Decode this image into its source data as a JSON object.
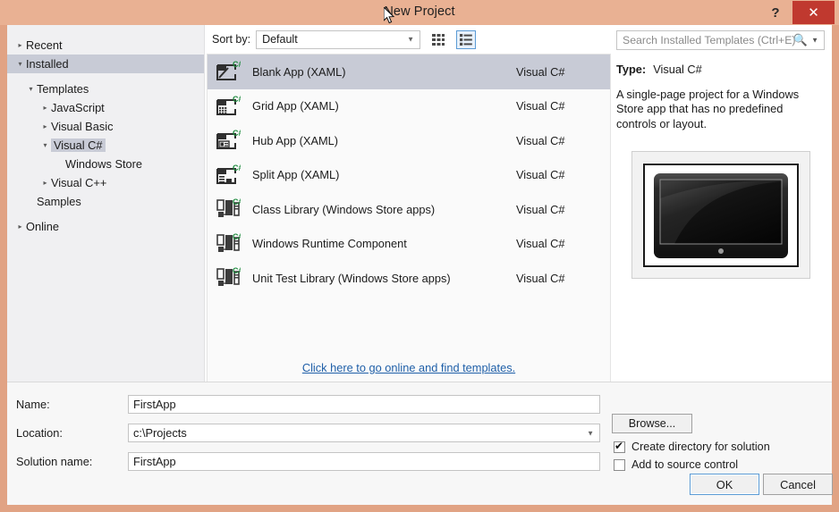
{
  "window": {
    "title": "New Project",
    "help_label": "?",
    "close_label": "✕"
  },
  "sidebar": {
    "items": [
      {
        "label": "Recent",
        "depth": 0,
        "state": "collapsed",
        "selected": false
      },
      {
        "label": "Installed",
        "depth": 0,
        "state": "expanded",
        "selected": true
      },
      {
        "label": "Templates",
        "depth": 1,
        "state": "expanded",
        "selected": false
      },
      {
        "label": "JavaScript",
        "depth": 2,
        "state": "collapsed",
        "selected": false
      },
      {
        "label": "Visual Basic",
        "depth": 2,
        "state": "collapsed",
        "selected": false
      },
      {
        "label": "Visual C#",
        "depth": 2,
        "state": "expanded",
        "selected": true
      },
      {
        "label": "Windows Store",
        "depth": 3,
        "state": "blank",
        "selected": false
      },
      {
        "label": "Visual C++",
        "depth": 2,
        "state": "collapsed",
        "selected": false
      },
      {
        "label": "Samples",
        "depth": 1,
        "state": "blank",
        "selected": false
      },
      {
        "label": "Online",
        "depth": 0,
        "state": "collapsed",
        "selected": false
      }
    ]
  },
  "toolbar": {
    "sort_label": "Sort by:",
    "sort_value": "Default",
    "tile_view_name": "tile-view",
    "list_view_name": "list-view",
    "list_view_active": true
  },
  "templates": {
    "rows": [
      {
        "name": "Blank App (XAML)",
        "lang": "Visual C#",
        "icon": "blank-app-icon",
        "selected": true
      },
      {
        "name": "Grid App (XAML)",
        "lang": "Visual C#",
        "icon": "grid-app-icon",
        "selected": false
      },
      {
        "name": "Hub App (XAML)",
        "lang": "Visual C#",
        "icon": "hub-app-icon",
        "selected": false
      },
      {
        "name": "Split App (XAML)",
        "lang": "Visual C#",
        "icon": "split-app-icon",
        "selected": false
      },
      {
        "name": "Class Library (Windows Store apps)",
        "lang": "Visual C#",
        "icon": "class-library-icon",
        "selected": false
      },
      {
        "name": "Windows Runtime Component",
        "lang": "Visual C#",
        "icon": "class-library-icon",
        "selected": false
      },
      {
        "name": "Unit Test Library (Windows Store apps)",
        "lang": "Visual C#",
        "icon": "class-library-icon",
        "selected": false
      }
    ],
    "online_link": "Click here to go online and find templates."
  },
  "search": {
    "placeholder": "Search Installed Templates (Ctrl+E)",
    "value": ""
  },
  "details": {
    "type_label": "Type:",
    "type_value": "Visual C#",
    "description": "A single-page project for a Windows Store app that has no predefined controls or layout.",
    "preview_name": "template-preview-monitor"
  },
  "form": {
    "name_label": "Name:",
    "name_value": "FirstApp",
    "location_label": "Location:",
    "location_value": "c:\\Projects",
    "solution_label": "Solution name:",
    "solution_value": "FirstApp",
    "browse_label": "Browse...",
    "create_dir_label": "Create directory for solution",
    "create_dir_checked": true,
    "source_control_label": "Add to source control",
    "source_control_checked": false,
    "ok_label": "OK",
    "cancel_label": "Cancel"
  },
  "colors": {
    "frame": "#e1a384",
    "titlebar": "#e9b193",
    "close": "#c0392f",
    "selection": "#c8cbd6",
    "link": "#1f5fa8",
    "focus": "#5b9bd5",
    "sidebar_bg": "#f0f0f2",
    "bottom_bg": "#f7f7f7"
  }
}
